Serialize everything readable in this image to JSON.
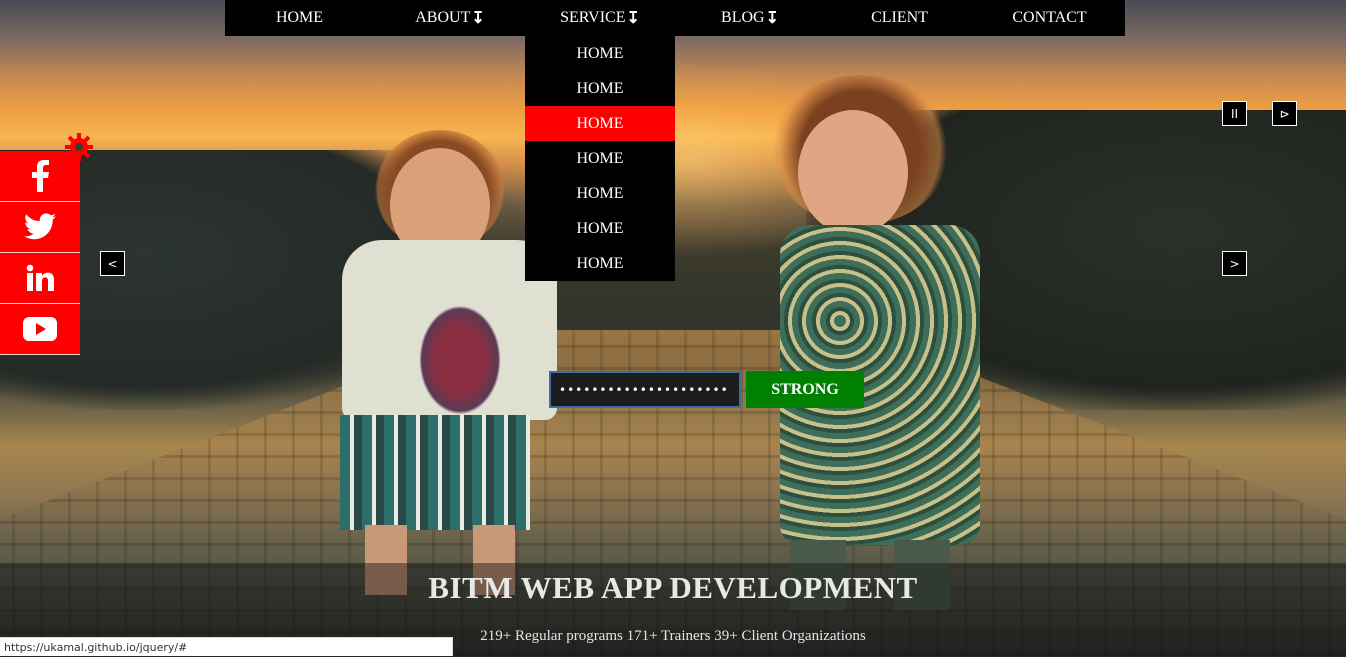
{
  "nav": {
    "items": [
      {
        "label": "HOME",
        "arrow": ""
      },
      {
        "label": "ABOUT",
        "arrow": "↧"
      },
      {
        "label": "SERVICE",
        "arrow": "↧"
      },
      {
        "label": "BLOG",
        "arrow": "↧"
      },
      {
        "label": "CLIENT",
        "arrow": ""
      },
      {
        "label": "CONTACT",
        "arrow": ""
      }
    ]
  },
  "dropdown": {
    "items": [
      "HOME",
      "HOME",
      "HOME",
      "HOME",
      "HOME",
      "HOME",
      "HOME"
    ],
    "active_index": 2,
    "active_color": "#ff0000"
  },
  "social": {
    "icons": [
      "facebook-icon",
      "twitter-icon",
      "linkedin-icon",
      "youtube-icon"
    ],
    "color": "#ff0000"
  },
  "slider": {
    "prev_label": "<",
    "next_label": ">",
    "pause_label": "II",
    "play_label": "⊳"
  },
  "password_form": {
    "value": "•••••••••••••••••••••",
    "strength_label": "STRONG",
    "strength_color": "#008000"
  },
  "banner": {
    "title": "BITM WEB APP DEVELOPMENT",
    "subtitle": "219+ Regular programs 171+ Trainers 39+ Client Organizations"
  },
  "status_bar": {
    "url": "https://ukamal.github.io/jquery/#"
  }
}
